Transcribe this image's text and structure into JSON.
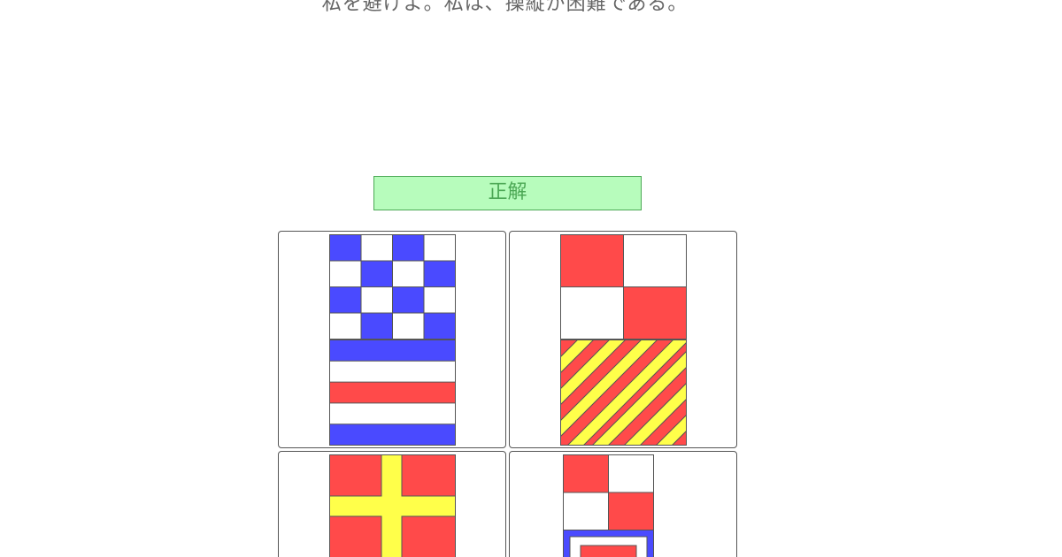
{
  "question": {
    "text": "私を避けよ。私は、操縦が困難である。"
  },
  "result": {
    "label": "正解"
  },
  "colors": {
    "blue": "#4a4aff",
    "red": "#ff4a4a",
    "yellow": "#ffff4a",
    "white": "#ffffff",
    "outline": "#555555",
    "banner_bg": "#b7fcbc",
    "banner_text": "#4ca855"
  },
  "choices": [
    {
      "flags": [
        "N",
        "C"
      ],
      "description": "blue-white checkered flag over blue-white-red-white-blue striped flag"
    },
    {
      "flags": [
        "U",
        "Y"
      ],
      "description": "red-white quartered flag over red-yellow diagonal striped flag"
    },
    {
      "flags": [
        "R"
      ],
      "description": "red flag with yellow cross"
    },
    {
      "flags": [
        "U",
        "E"
      ],
      "description": "red-white quartered flag over blue bordered flag"
    }
  ]
}
